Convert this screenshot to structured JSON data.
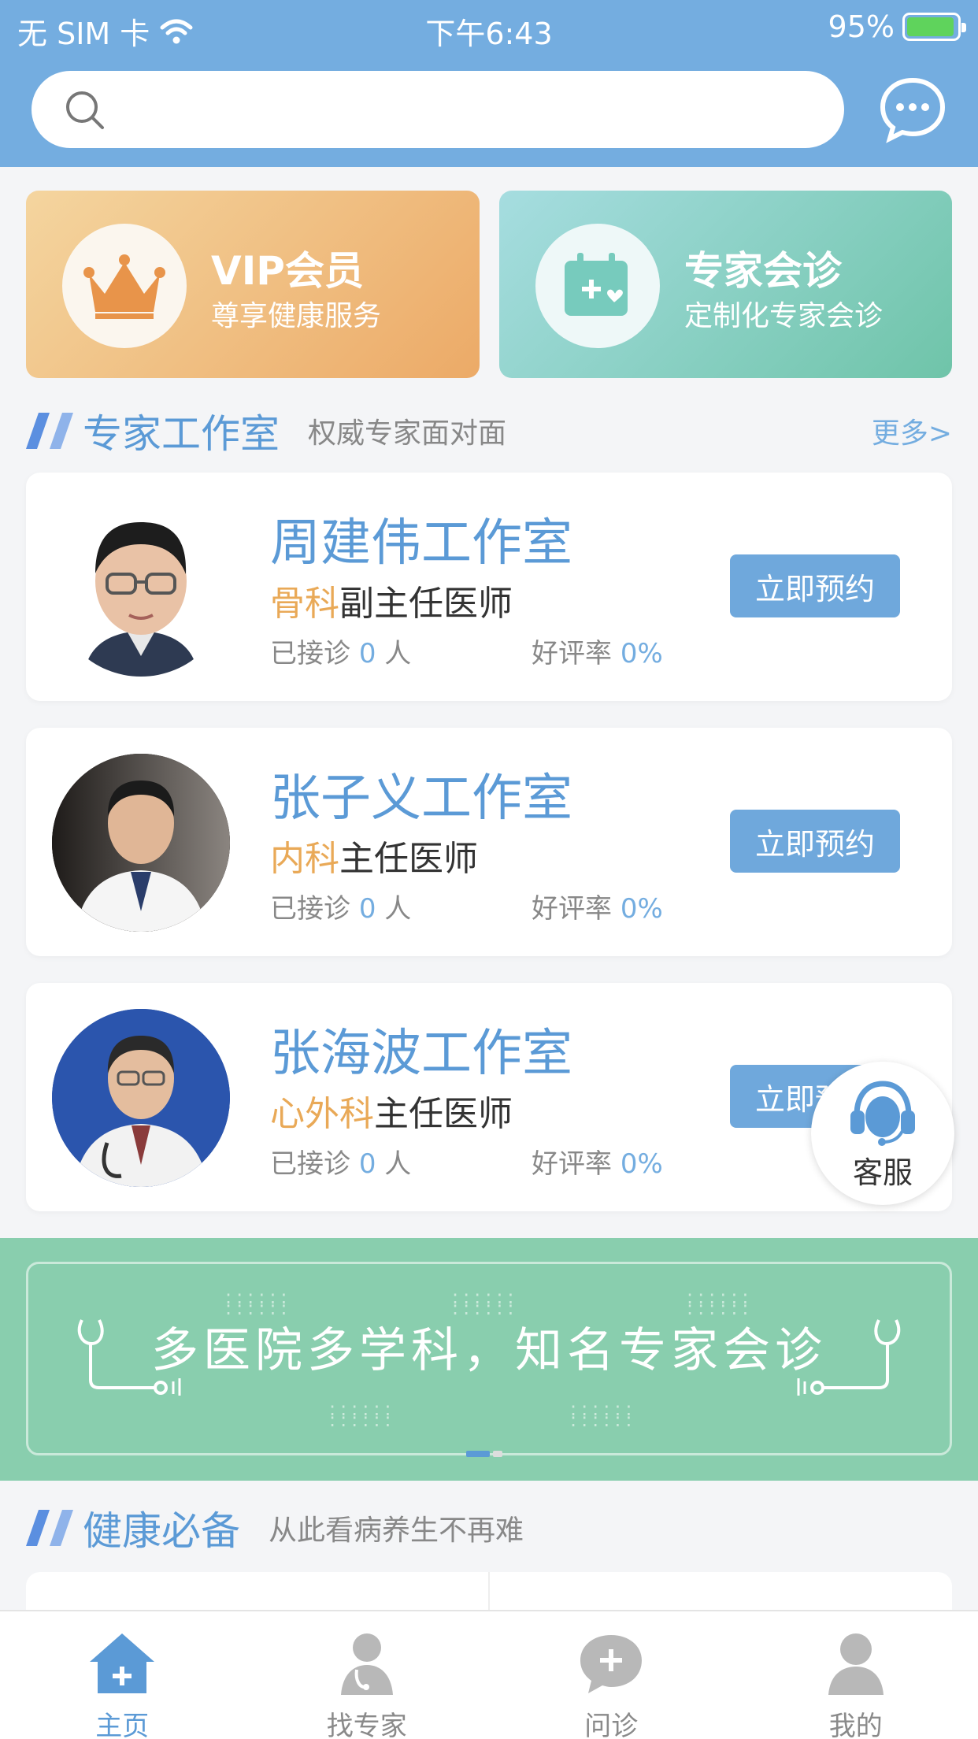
{
  "status": {
    "carrier": "无 SIM 卡",
    "time": "下午6:43",
    "battery": "95%"
  },
  "search": {
    "placeholder": ""
  },
  "promos": [
    {
      "title": "VIP会员",
      "sub": "尊享健康服务",
      "icon": "crown-icon"
    },
    {
      "title": "专家会诊",
      "sub": "定制化专家会诊",
      "icon": "calendar-heart-icon"
    }
  ],
  "experts_section": {
    "title": "专家工作室",
    "subtitle": "权威专家面对面",
    "more": "更多>"
  },
  "doctors": [
    {
      "name": "周建伟工作室",
      "dept": "骨科",
      "title": "副主任医师",
      "visits_label": "已接诊",
      "visits": "0",
      "unit": "人",
      "rate_label": "好评率",
      "rate": "0%",
      "book": "立即预约"
    },
    {
      "name": "张子义工作室",
      "dept": "内科",
      "title": "主任医师",
      "visits_label": "已接诊",
      "visits": "0",
      "unit": "人",
      "rate_label": "好评率",
      "rate": "0%",
      "book": "立即预约"
    },
    {
      "name": "张海波工作室",
      "dept": "心外科",
      "title": "主任医师",
      "visits_label": "已接诊",
      "visits": "0",
      "unit": "人",
      "rate_label": "好评率",
      "rate": "0%",
      "book": "立即预约"
    }
  ],
  "service": {
    "label": "客服"
  },
  "banner": {
    "text": "多医院多学科，知名专家会诊"
  },
  "health_section": {
    "title": "健康必备",
    "subtitle": "从此看病养生不再难"
  },
  "tabs": [
    {
      "label": "主页",
      "icon": "home-icon",
      "active": true
    },
    {
      "label": "找专家",
      "icon": "doctor-icon",
      "active": false
    },
    {
      "label": "问诊",
      "icon": "chat-plus-icon",
      "active": false
    },
    {
      "label": "我的",
      "icon": "user-icon",
      "active": false
    }
  ],
  "colors": {
    "header": "#74ade0",
    "accent": "#5b9ad6",
    "dept": "#e9a957",
    "banner": "#89ceae"
  }
}
